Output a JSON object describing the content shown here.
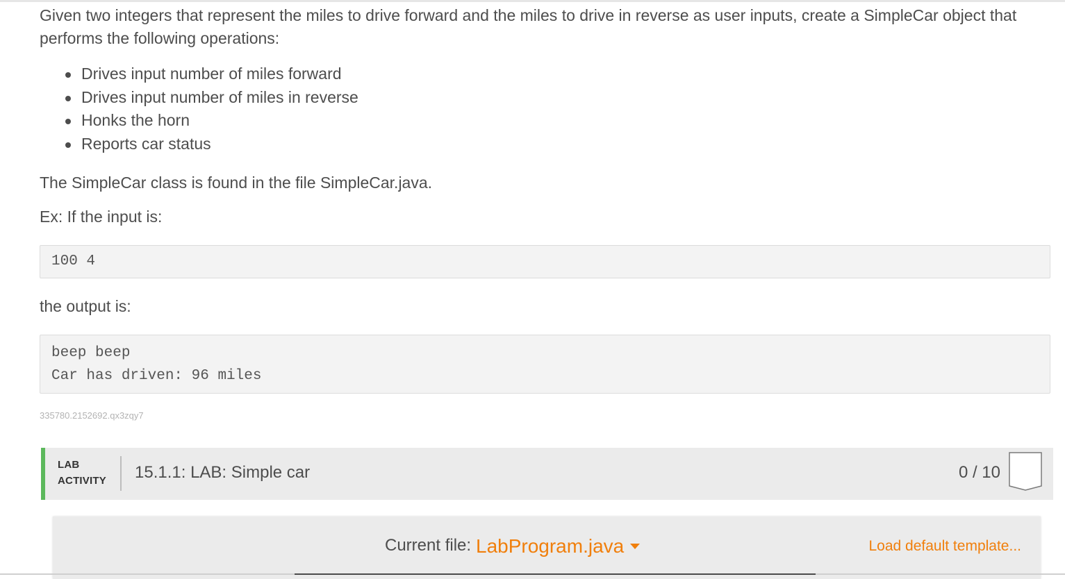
{
  "problem": {
    "intro": "Given two integers that represent the miles to drive forward and the miles to drive in reverse as user inputs, create a SimpleCar object that performs the following operations:",
    "operations": [
      "Drives input number of miles forward",
      "Drives input number of miles in reverse",
      "Honks the horn",
      "Reports car status"
    ],
    "class_note": "The SimpleCar class is found in the file SimpleCar.java.",
    "example_label": "Ex: If the input is:",
    "example_input": "100 4",
    "output_label": "the output is:",
    "example_output": [
      "beep beep",
      "Car has driven: 96 miles"
    ],
    "lab_id": "335780.2152692.qx3zqy7"
  },
  "lab": {
    "type_line1": "LAB",
    "type_line2": "ACTIVITY",
    "title": "15.1.1: LAB: Simple car",
    "score": "0 / 10",
    "accent_color": "#5cb85c"
  },
  "editor": {
    "current_file_label": "Current file:",
    "file_name": "LabProgram.java",
    "load_default": "Load default template...",
    "accent_color": "#f07f0c"
  }
}
